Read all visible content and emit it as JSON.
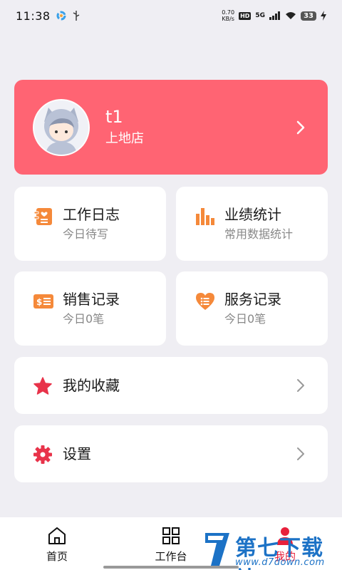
{
  "status_bar": {
    "time": "11:38",
    "net_speed_value": "0.70",
    "net_speed_unit": "KB/s",
    "hd": "HD",
    "network": "5G",
    "battery": "33"
  },
  "profile": {
    "name": "t1",
    "store": "上地店"
  },
  "grid": [
    {
      "title": "工作日志",
      "subtitle": "今日待写",
      "icon": "worklog-icon"
    },
    {
      "title": "业绩统计",
      "subtitle": "常用数据统计",
      "icon": "bar-chart-icon"
    },
    {
      "title": "销售记录",
      "subtitle": "今日0笔",
      "icon": "sales-receipt-icon"
    },
    {
      "title": "服务记录",
      "subtitle": "今日0笔",
      "icon": "heart-list-icon"
    }
  ],
  "list": {
    "favorites": {
      "label": "我的收藏",
      "icon": "star-icon"
    },
    "settings": {
      "label": "设置",
      "icon": "gear-icon"
    }
  },
  "tabs": [
    {
      "label": "首页",
      "icon": "home-icon",
      "active": false
    },
    {
      "label": "工作台",
      "icon": "grid-icon",
      "active": false
    },
    {
      "label": "我的",
      "icon": "person-icon",
      "active": true
    }
  ],
  "watermark": {
    "title": "第七下载站",
    "url": "www.d7down.com"
  },
  "colors": {
    "accent_red": "#ff6473",
    "orange": "#f5893a",
    "star_red": "#e8334a",
    "background": "#efeef3"
  }
}
